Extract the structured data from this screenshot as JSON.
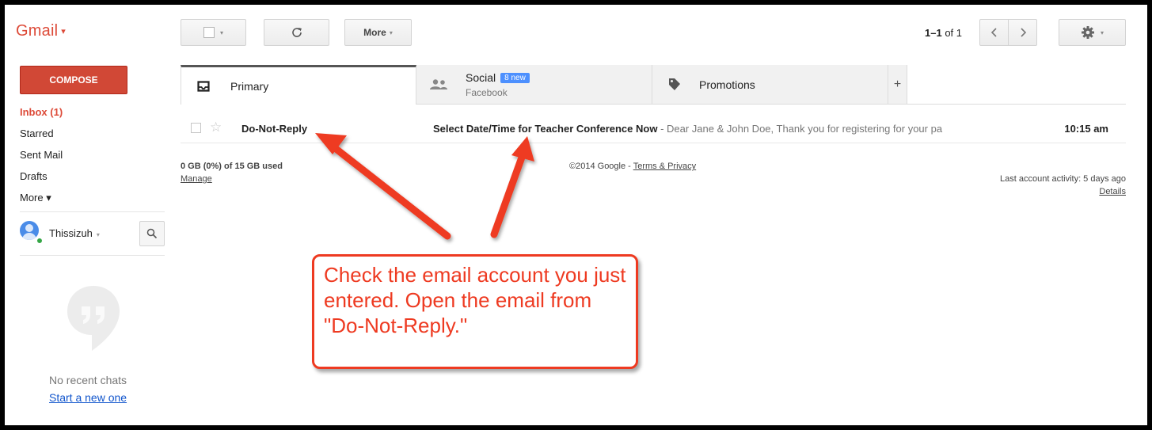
{
  "brand": {
    "name": "Gmail",
    "caret": "▾"
  },
  "toolbar": {
    "select_caret": "▾",
    "refresh_icon": "C",
    "more_label": "More",
    "more_caret": "▾",
    "pagination": {
      "range": "1–1",
      "of": "of 1"
    },
    "settings_caret": "▾"
  },
  "sidebar": {
    "compose_label": "COMPOSE",
    "items": [
      {
        "label": "Inbox (1)",
        "active": true
      },
      {
        "label": "Starred"
      },
      {
        "label": "Sent Mail"
      },
      {
        "label": "Drafts"
      },
      {
        "label": "More ▾"
      }
    ],
    "user": {
      "name": "Thissizuh",
      "caret": "▾"
    },
    "chat": {
      "empty_text": "No recent chats",
      "start_link": "Start a new one"
    }
  },
  "tabs": [
    {
      "label": "Primary",
      "icon": "inbox-icon",
      "selected": true
    },
    {
      "label": "Social",
      "badge": "8 new",
      "sub": "Facebook",
      "icon": "people-icon"
    },
    {
      "label": "Promotions",
      "icon": "tag-icon"
    },
    {
      "label": "+",
      "icon": "add-tab"
    }
  ],
  "messages": [
    {
      "sender": "Do-Not-Reply",
      "subject": "Select Date/Time for Teacher Conference Now",
      "snippet": " - Dear Jane & John Doe, Thank you for registering for your pa",
      "time": "10:15 am",
      "starred": false
    }
  ],
  "footer": {
    "storage": "0 GB (0%) of 15 GB used",
    "manage": "Manage",
    "copyright": "©2014 Google - ",
    "terms": "Terms & Privacy",
    "activity": "Last account activity: 5 days ago",
    "details": "Details"
  },
  "annotation": {
    "text": "Check the email account you just entered. Open the email from \"Do-Not-Reply.\"",
    "color": "#ee3a21"
  },
  "colors": {
    "gmail_red": "#dd4b39",
    "compose": "#d14836",
    "link": "#1155cc",
    "badge": "#4d90fe"
  }
}
